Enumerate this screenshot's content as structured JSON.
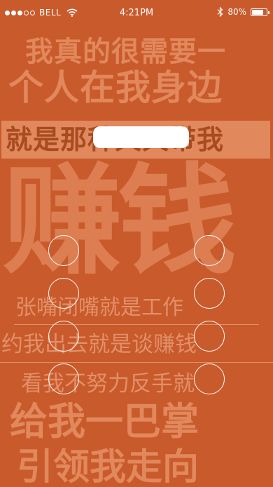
{
  "status": {
    "signal_dots": 5,
    "signal_active": 3,
    "carrier": "BELL",
    "time": "4:21PM",
    "battery": "80%",
    "battery_level": 0.8
  },
  "poster": {
    "line1": "我真的很需要一",
    "line2": "个人在我身边",
    "line3": "就是那种天天带我",
    "line4": "赚钱",
    "line5": "张嘴闭嘴就是工作",
    "line6": "约我出去就是谈赚钱",
    "line7": "看我不努力反手就",
    "line8": "给我一巴掌",
    "line9": "引领我走向"
  },
  "colors": {
    "background": "#c95a2c",
    "poster_text": "#e1885c"
  },
  "icons": {
    "wifi": "wifi-icon",
    "bluetooth": "bluetooth-icon",
    "battery": "battery-icon"
  }
}
